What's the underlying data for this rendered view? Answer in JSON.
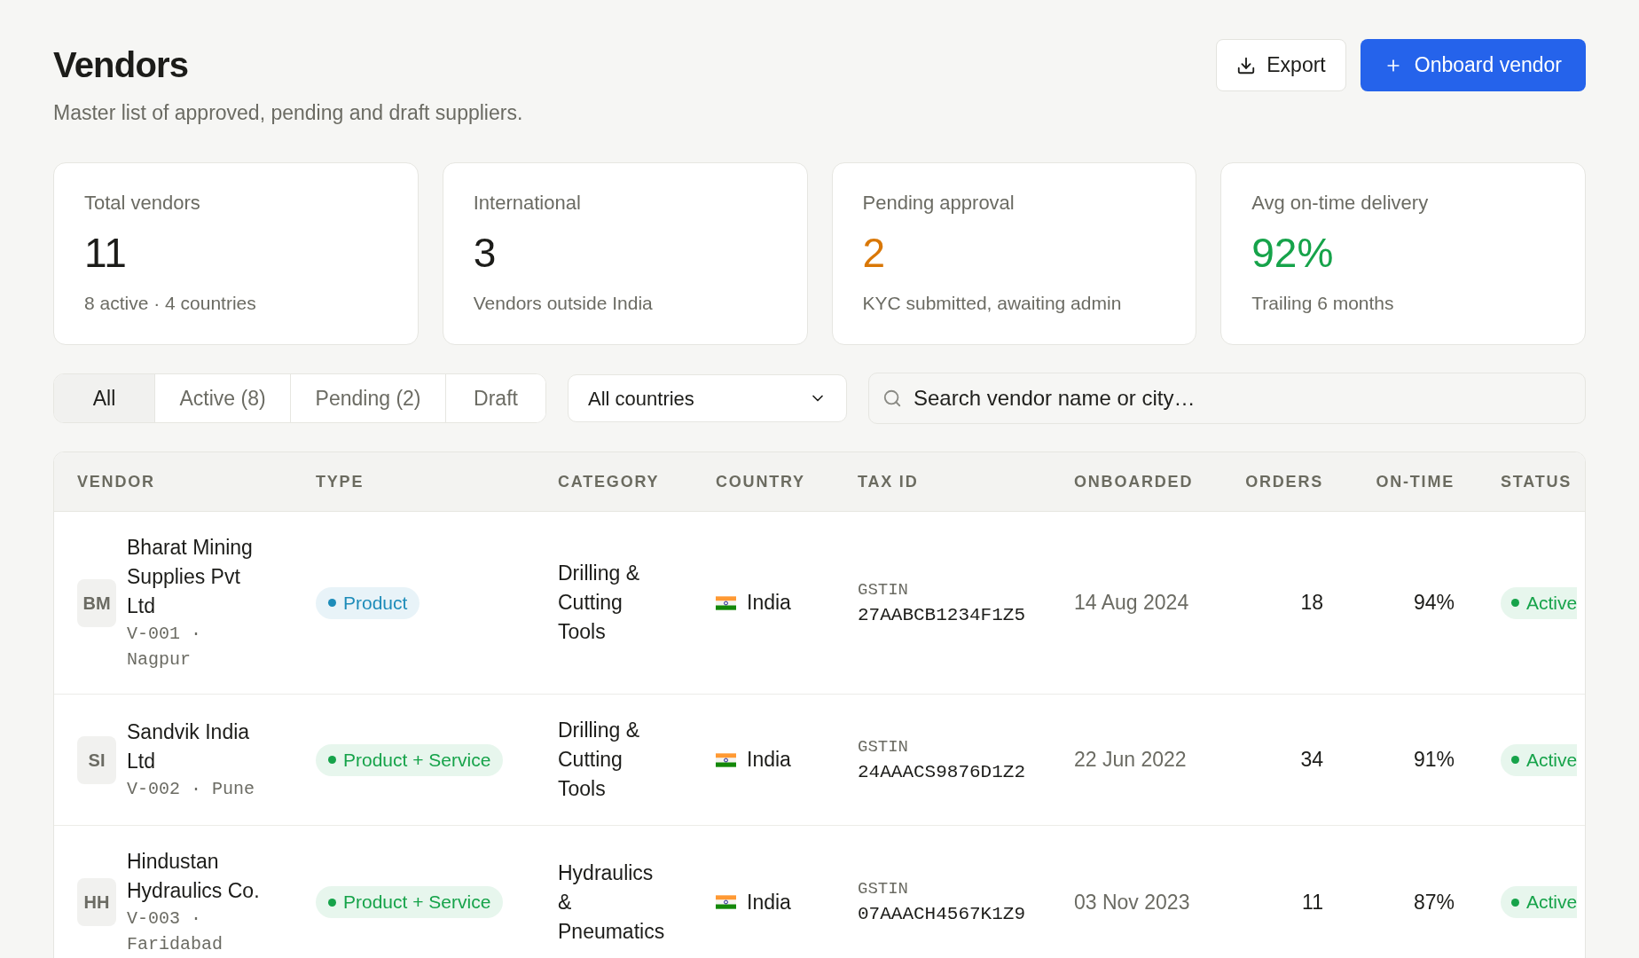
{
  "header": {
    "title": "Vendors",
    "subtitle": "Master list of approved, pending and draft suppliers.",
    "actions": [
      {
        "label": "Export",
        "kind": "secondary"
      },
      {
        "label": "Onboard vendor",
        "kind": "primary"
      }
    ]
  },
  "stats": [
    {
      "label": "Total vendors",
      "value": "11",
      "color": "#1c1c19",
      "note": "8 active · 4 countries"
    },
    {
      "label": "International",
      "value": "3",
      "color": "#1c1c19",
      "note": "Vendors outside India"
    },
    {
      "label": "Pending approval",
      "value": "2",
      "color": "#d97706",
      "note": "KYC submitted, awaiting admin"
    },
    {
      "label": "Avg on-time delivery",
      "value": "92%",
      "color": "#16a34a",
      "note": "Trailing 6 months"
    }
  ],
  "filters": {
    "tabs": [
      {
        "label": "All",
        "selected": true
      },
      {
        "label": "Active (8)",
        "selected": false
      },
      {
        "label": "Pending (2)",
        "selected": false
      },
      {
        "label": "Draft",
        "selected": false
      }
    ],
    "country_filter": {
      "value": "All countries"
    },
    "search": {
      "placeholder": "Search vendor name or city…"
    }
  },
  "table": {
    "columns": [
      {
        "label": "VENDOR",
        "kind": "text"
      },
      {
        "label": "TYPE",
        "kind": "text"
      },
      {
        "label": "CATEGORY",
        "kind": "text"
      },
      {
        "label": "COUNTRY",
        "kind": "text"
      },
      {
        "label": "TAX ID",
        "kind": "text"
      },
      {
        "label": "ONBOARDED",
        "kind": "text"
      },
      {
        "label": "ORDERS",
        "kind": "number"
      },
      {
        "label": "ON-TIME",
        "kind": "number"
      },
      {
        "label": "STATUS",
        "kind": "text"
      }
    ],
    "rows": [
      {
        "initials": "BM",
        "name": "Bharat Mining Supplies Pvt Ltd",
        "code_city": "V-001 · Nagpur",
        "type": {
          "label": "Product",
          "color": "#1d8cb9"
        },
        "category": "Drilling & Cutting Tools",
        "country": "India",
        "tax_label": "GSTIN",
        "tax_id": "27AABCB1234F1Z5",
        "onboarded": "14 Aug 2024",
        "orders": "18",
        "on_time": "94%",
        "status": {
          "label": "Active",
          "color": "#16a34a"
        }
      },
      {
        "initials": "SI",
        "name": "Sandvik India Ltd",
        "code_city": "V-002 · Pune",
        "type": {
          "label": "Product + Service",
          "color": "#16a34a"
        },
        "category": "Drilling & Cutting Tools",
        "country": "India",
        "tax_label": "GSTIN",
        "tax_id": "24AAACS9876D1Z2",
        "onboarded": "22 Jun 2022",
        "orders": "34",
        "on_time": "91%",
        "status": {
          "label": "Active",
          "color": "#16a34a"
        }
      },
      {
        "initials": "HH",
        "name": "Hindustan Hydraulics Co.",
        "code_city": "V-003 · Faridabad",
        "type": {
          "label": "Product + Service",
          "color": "#16a34a"
        },
        "category": "Hydraulics & Pneumatics",
        "country": "India",
        "tax_label": "GSTIN",
        "tax_id": "07AAACH4567K1Z9",
        "onboarded": "03 Nov 2023",
        "orders": "11",
        "on_time": "87%",
        "status": {
          "label": "Active",
          "color": "#16a34a"
        }
      }
    ]
  }
}
